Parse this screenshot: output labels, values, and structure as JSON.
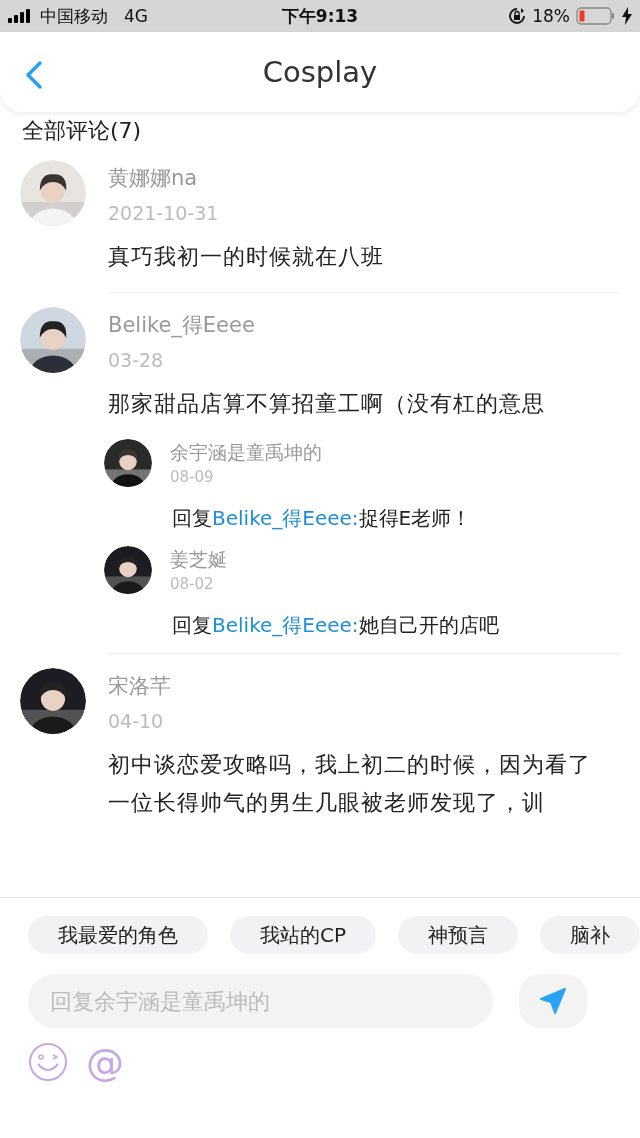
{
  "status_bar": {
    "carrier": "中国移动",
    "network": "4G",
    "time": "下午9:13",
    "battery": "18%"
  },
  "header": {
    "title": "Cosplay"
  },
  "comments_heading": "全部评论(7)",
  "comments": [
    {
      "author": "黄娜娜na",
      "date": "2021-10-31",
      "text": "真巧我初一的时候就在八班"
    },
    {
      "author": "Belike_得Eeee",
      "date": "03-28",
      "text": "那家甜品店算不算招童工啊（没有杠的意思",
      "replies": [
        {
          "author": "余宇涵是童禹坤的",
          "date": "08-09",
          "prefix": "回复",
          "target": "Belike_得Eeee:",
          "text": "捉得E老师！"
        },
        {
          "author": "姜芝娫",
          "date": "08-02",
          "prefix": "回复",
          "target": "Belike_得Eeee:",
          "text": "她自己开的店吧"
        }
      ]
    },
    {
      "author": "宋洛芊",
      "date": "04-10",
      "text": "初中谈恋爱攻略吗，我上初二的时候，因为看了一位长得帅气的男生几眼被老师发现了，训"
    }
  ],
  "composer": {
    "tags": [
      "我最爱的角色",
      "我站的CP",
      "神预言",
      "脑补"
    ],
    "placeholder": "回复余宇涵是童禹坤的",
    "mention_symbol": "@"
  }
}
